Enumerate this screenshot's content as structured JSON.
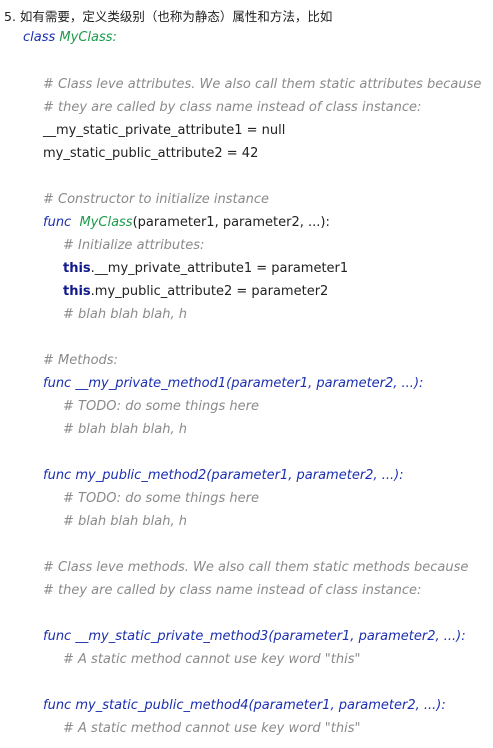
{
  "heading": "5. 如有需要，定义类级别（也称为静态）属性和方法，比如",
  "code": {
    "class_keyword": "class",
    "class_name": "MyClass:",
    "comment_attr_1": "# Class leve attributes. We also call them static attributes because",
    "comment_attr_2": "# they are called by class name instead of class instance:",
    "static_private_attr": "__my_static_private_attribute1 = null",
    "static_public_attr": "my_static_public_attribute2 = 42",
    "comment_constructor": "# Constructor to initialize instance",
    "func_keyword": "func",
    "constructor_name": "MyClass",
    "constructor_params": "(parameter1, parameter2, ...):",
    "comment_init_attrs": "# Initialize attributes:",
    "this_keyword": "this",
    "private_attr_assign": ".__my_private_attribute1 = parameter1",
    "public_attr_assign": ".my_public_attribute2 = parameter2",
    "comment_blah": "# blah blah blah, h",
    "comment_methods": "# Methods:",
    "private_method_sig": "__my_private_method1(parameter1, parameter2, ...):",
    "comment_todo": "# TODO: do some things here",
    "public_method_sig": "my_public_method2(parameter1, parameter2, ...):",
    "comment_static_1": "# Class leve methods. We also call them static methods because",
    "comment_static_2": "# they are called by class name instead of class instance:",
    "static_private_method_sig": "__my_static_private_method3(parameter1, parameter2, ...):",
    "comment_static_this": "# A static method cannot use key word \"this\"",
    "static_public_method_sig": "my_static_public_method4(parameter1, parameter2, ...):"
  }
}
